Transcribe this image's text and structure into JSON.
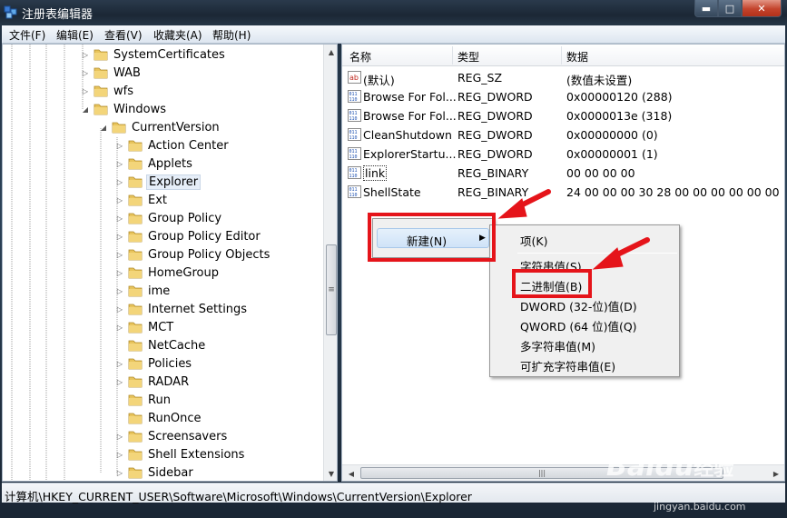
{
  "window": {
    "title": "注册表编辑器",
    "controls": {
      "minimize": "▬",
      "maximize": "□",
      "close": "✕"
    }
  },
  "menu": [
    "文件(F)",
    "编辑(E)",
    "查看(V)",
    "收藏夹(A)",
    "帮助(H)"
  ],
  "tree": {
    "items": [
      {
        "label": "SystemCertificates",
        "level": 0,
        "expander": "right"
      },
      {
        "label": "WAB",
        "level": 0,
        "expander": "right"
      },
      {
        "label": "wfs",
        "level": 0,
        "expander": "right"
      },
      {
        "label": "Windows",
        "level": 0,
        "expander": "down"
      },
      {
        "label": "CurrentVersion",
        "level": 1,
        "expander": "down"
      },
      {
        "label": "Action Center",
        "level": 2,
        "expander": "right"
      },
      {
        "label": "Applets",
        "level": 2,
        "expander": "right"
      },
      {
        "label": "Explorer",
        "level": 2,
        "expander": "right",
        "selected": true
      },
      {
        "label": "Ext",
        "level": 2,
        "expander": "right"
      },
      {
        "label": "Group Policy",
        "level": 2,
        "expander": "right"
      },
      {
        "label": "Group Policy Editor",
        "level": 2,
        "expander": "right"
      },
      {
        "label": "Group Policy Objects",
        "level": 2,
        "expander": "right"
      },
      {
        "label": "HomeGroup",
        "level": 2,
        "expander": "right"
      },
      {
        "label": "ime",
        "level": 2,
        "expander": "right"
      },
      {
        "label": "Internet Settings",
        "level": 2,
        "expander": "right"
      },
      {
        "label": "MCT",
        "level": 2,
        "expander": "right"
      },
      {
        "label": "NetCache",
        "level": 2,
        "expander": "none"
      },
      {
        "label": "Policies",
        "level": 2,
        "expander": "right"
      },
      {
        "label": "RADAR",
        "level": 2,
        "expander": "right"
      },
      {
        "label": "Run",
        "level": 2,
        "expander": "none"
      },
      {
        "label": "RunOnce",
        "level": 2,
        "expander": "none"
      },
      {
        "label": "Screensavers",
        "level": 2,
        "expander": "right"
      },
      {
        "label": "Shell Extensions",
        "level": 2,
        "expander": "right"
      },
      {
        "label": "Sidebar",
        "level": 2,
        "expander": "right"
      }
    ]
  },
  "list": {
    "columns": [
      "名称",
      "类型",
      "数据"
    ],
    "rows": [
      {
        "icon": "string-value-icon",
        "name": "(默认)",
        "type": "REG_SZ",
        "data": "(数值未设置)"
      },
      {
        "icon": "binary-value-icon",
        "name": "Browse For Fol...",
        "type": "REG_DWORD",
        "data": "0x00000120 (288)"
      },
      {
        "icon": "binary-value-icon",
        "name": "Browse For Fol...",
        "type": "REG_DWORD",
        "data": "0x0000013e (318)"
      },
      {
        "icon": "binary-value-icon",
        "name": "CleanShutdown",
        "type": "REG_DWORD",
        "data": "0x00000000 (0)"
      },
      {
        "icon": "binary-value-icon",
        "name": "ExplorerStartu...",
        "type": "REG_DWORD",
        "data": "0x00000001 (1)"
      },
      {
        "icon": "binary-value-icon",
        "name": "link",
        "type": "REG_BINARY",
        "data": "00 00 00 00"
      },
      {
        "icon": "binary-value-icon",
        "name": "ShellState",
        "type": "REG_BINARY",
        "data": "24 00 00 00 30 28 00 00 00 00 00 00"
      }
    ]
  },
  "context_menu": {
    "new_label": "新建(N)",
    "submenu": {
      "key": "项(K)",
      "items": [
        "字符串值(S)",
        "二进制值(B)",
        "DWORD (32-位)值(D)",
        "QWORD (64 位)值(Q)",
        "多字符串值(M)",
        "可扩充字符串值(E)"
      ]
    }
  },
  "status": {
    "path": "计算机\\HKEY_CURRENT_USER\\Software\\Microsoft\\Windows\\CurrentVersion\\Explorer"
  },
  "watermark": {
    "brand": "Baidu",
    "brand2": "经验",
    "url": "jingyan.baidu.com"
  },
  "colors": {
    "annotation_red": "#e5141a",
    "folder": "#e8c45c"
  }
}
